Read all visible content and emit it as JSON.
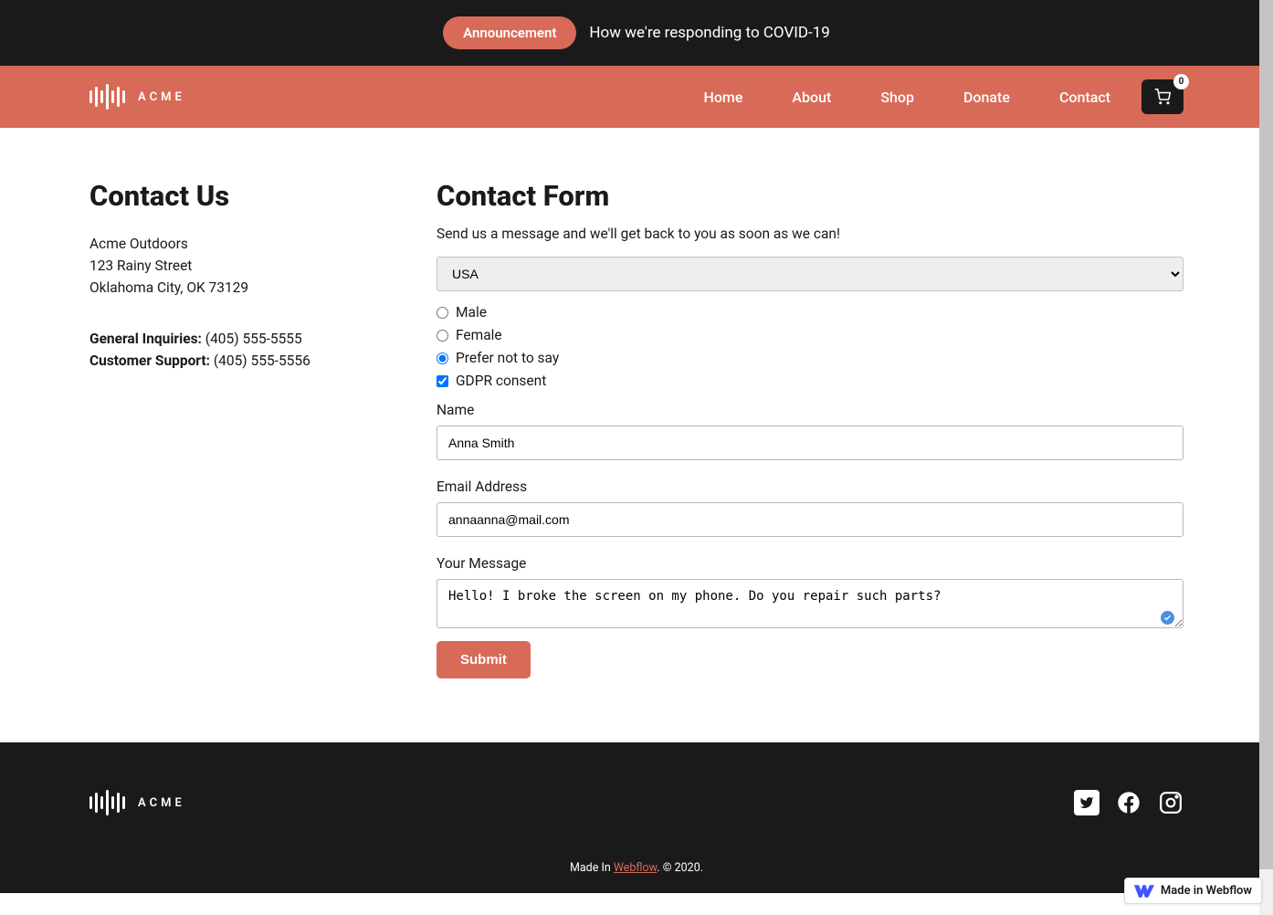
{
  "announcement": {
    "pill": "Announcement",
    "text": "How we're responding to COVID-19"
  },
  "brand": "ACME",
  "nav": {
    "home": "Home",
    "about": "About",
    "shop": "Shop",
    "donate": "Donate",
    "contact": "Contact"
  },
  "cart": {
    "count": "0"
  },
  "contact": {
    "title": "Contact Us",
    "company": "Acme Outdoors",
    "street": "123 Rainy Street",
    "city": "Oklahoma City, OK 73129",
    "inq_label": "General Inquiries:",
    "inq_phone": "(405) 555-5555",
    "sup_label": "Customer Support:",
    "sup_phone": "(405) 555-5556"
  },
  "form": {
    "title": "Contact Form",
    "subtitle": "Send us a message and we'll get back to you as soon as we can!",
    "country": "USA",
    "radio_male": "Male",
    "radio_female": "Female",
    "radio_pnts": "Prefer not to say",
    "gdpr": "GDPR consent",
    "name_label": "Name",
    "name_value": "Anna Smith",
    "email_label": "Email Address",
    "email_value": "annaanna@mail.com",
    "msg_label": "Your Message",
    "msg_value": "Hello! I broke the screen on my phone. Do you repair such parts?",
    "submit": "Submit"
  },
  "footer": {
    "made_in": "Made In ",
    "webflow": "Webflow",
    "suffix": ". © 2020."
  },
  "badge": "Made in Webflow"
}
